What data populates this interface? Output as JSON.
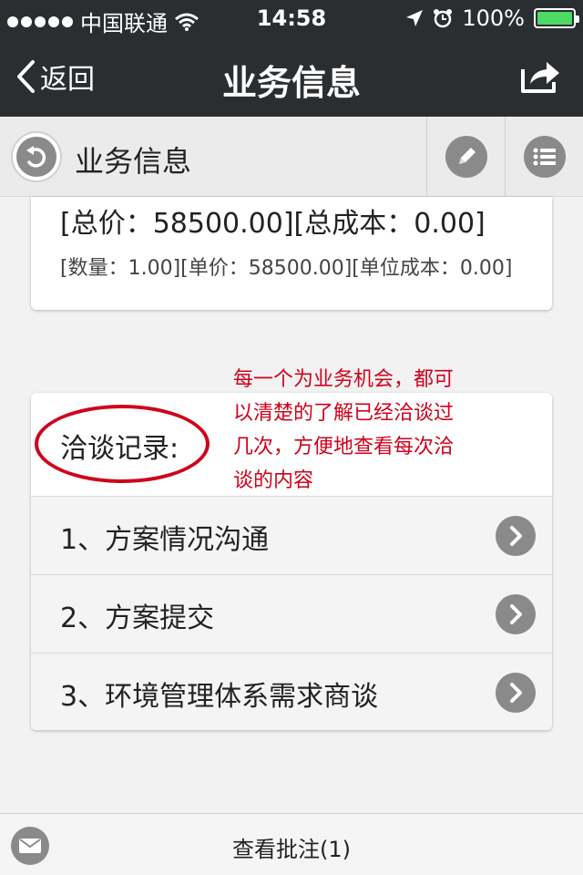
{
  "status_bar": {
    "carrier": "中国联通",
    "time": "14:58",
    "battery": "100%"
  },
  "nav": {
    "back_label": "返回",
    "title": "业务信息"
  },
  "sub_header": {
    "title": "业务信息"
  },
  "price": {
    "main": "[总价：58500.00][总成本：0.00]",
    "sub": "[数量：1.00][单价：58500.00][单位成本：0.00]"
  },
  "records": {
    "title": "洽谈记录:",
    "items": [
      {
        "label": "1、方案情况沟通"
      },
      {
        "label": "2、方案提交"
      },
      {
        "label": "3、环境管理体系需求商谈"
      }
    ]
  },
  "annotation": {
    "lines": [
      "每一个为业务机会，都可",
      "以清楚的了解已经洽谈过",
      "几次，方便地查看每次洽",
      "谈的内容"
    ]
  },
  "bottom": {
    "label": "查看批注(1)"
  },
  "colors": {
    "nav_bg": "#2b2e30",
    "battery": "#4cd964",
    "annotation": "#d0021b",
    "icon_gray": "#8a8a8a"
  },
  "icons": [
    "wifi-icon",
    "location-arrow-icon",
    "alarm-icon",
    "back-chevron-icon",
    "share-icon",
    "undo-icon",
    "pencil-icon",
    "list-icon",
    "chevron-right-icon",
    "mail-icon"
  ]
}
